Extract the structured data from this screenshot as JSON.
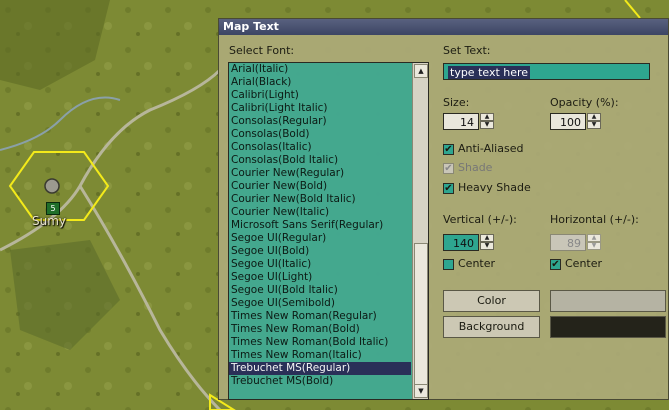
{
  "map": {
    "town_label": "Sumy",
    "unit_value": "5"
  },
  "dialog": {
    "title": "Map Text",
    "select_font_label": "Select Font:",
    "fonts": [
      "Arial(Italic)",
      "Arial(Black)",
      "Calibri(Light)",
      "Calibri(Light Italic)",
      "Consolas(Regular)",
      "Consolas(Bold)",
      "Consolas(Italic)",
      "Consolas(Bold Italic)",
      "Courier New(Regular)",
      "Courier New(Bold)",
      "Courier New(Bold Italic)",
      "Courier New(Italic)",
      "Microsoft Sans Serif(Regular)",
      "Segoe UI(Regular)",
      "Segoe UI(Bold)",
      "Segoe UI(Italic)",
      "Segoe UI(Light)",
      "Segoe UI(Bold Italic)",
      "Segoe UI(Semibold)",
      "Times New Roman(Regular)",
      "Times New Roman(Bold)",
      "Times New Roman(Bold Italic)",
      "Times New Roman(Italic)",
      "Trebuchet MS(Regular)",
      "Trebuchet MS(Bold)"
    ],
    "selected_font": "Trebuchet MS(Regular)",
    "set_text_label": "Set Text:",
    "text_value": "type text here",
    "size_label": "Size:",
    "size_value": "14",
    "opacity_label": "Opacity (%):",
    "opacity_value": "100",
    "anti_aliased_label": "Anti-Aliased",
    "shade_label": "Shade",
    "heavy_shade_label": "Heavy Shade",
    "vertical_label": "Vertical (+/-):",
    "vertical_value": "140",
    "horizontal_label": "Horizontal (+/-):",
    "horizontal_value": "89",
    "center_label": "Center",
    "color_button": "Color",
    "background_button": "Background",
    "colors": {
      "text_color": "#b5b3a3",
      "background_color": "#24231a",
      "list_bg": "#28a896",
      "selection": "#2a3058"
    }
  }
}
